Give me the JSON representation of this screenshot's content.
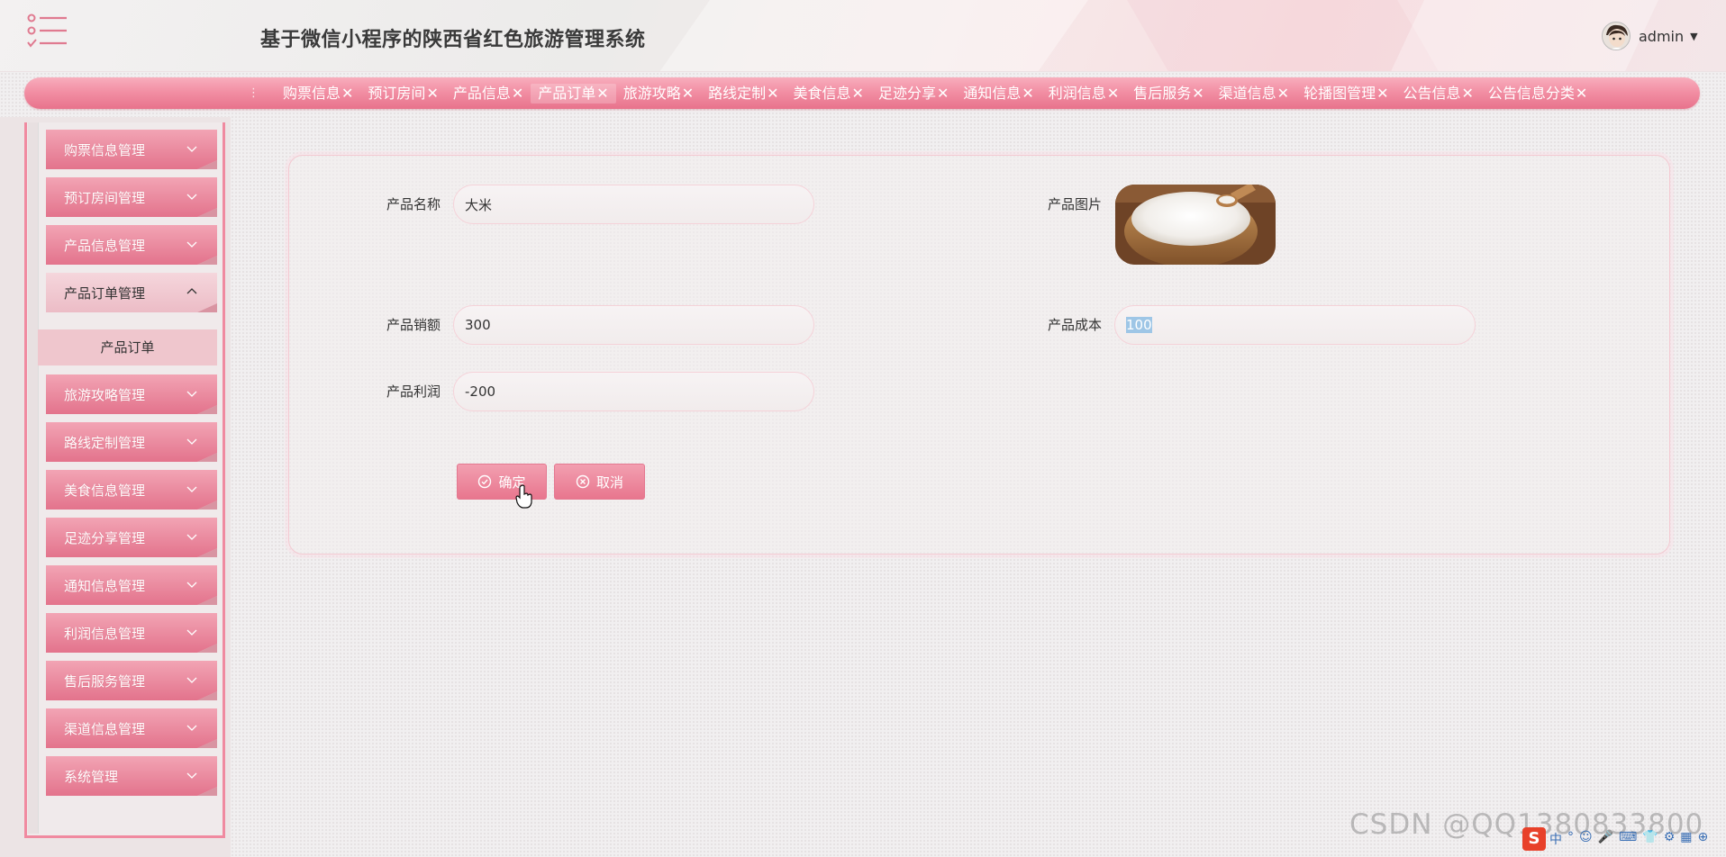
{
  "header": {
    "title": "基于微信小程序的陕西省红色旅游管理系统",
    "user_name": "admin",
    "caret": "▼"
  },
  "tabs": {
    "more": "⋮",
    "close_symbol": "✕",
    "items": [
      {
        "label": "购票信息"
      },
      {
        "label": "预订房间"
      },
      {
        "label": "产品信息"
      },
      {
        "label": "产品订单",
        "active": true
      },
      {
        "label": "旅游攻略"
      },
      {
        "label": "路线定制"
      },
      {
        "label": "美食信息"
      },
      {
        "label": "足迹分享"
      },
      {
        "label": "通知信息"
      },
      {
        "label": "利润信息"
      },
      {
        "label": "售后服务"
      },
      {
        "label": "渠道信息"
      },
      {
        "label": "轮播图管理"
      },
      {
        "label": "公告信息"
      },
      {
        "label": "公告信息分类"
      }
    ]
  },
  "sidebar": {
    "items": [
      {
        "label": "购票信息管理"
      },
      {
        "label": "预订房间管理"
      },
      {
        "label": "产品信息管理"
      },
      {
        "label": "产品订单管理",
        "open": true
      },
      {
        "label": "旅游攻略管理"
      },
      {
        "label": "路线定制管理"
      },
      {
        "label": "美食信息管理"
      },
      {
        "label": "足迹分享管理"
      },
      {
        "label": "通知信息管理"
      },
      {
        "label": "利润信息管理"
      },
      {
        "label": "售后服务管理"
      },
      {
        "label": "渠道信息管理"
      },
      {
        "label": "系统管理"
      }
    ],
    "sub_item": "产品订单"
  },
  "form": {
    "name_label": "产品名称",
    "name_value": "大米",
    "image_label": "产品图片",
    "sales_label": "产品销额",
    "sales_value": "300",
    "cost_label": "产品成本",
    "cost_value": "100",
    "profit_label": "产品利润",
    "profit_value": "-200",
    "confirm_label": "确定",
    "cancel_label": "取消"
  },
  "watermark": "CSDN @QQ1380833800",
  "tray": {
    "logo": "S",
    "icons": [
      "中",
      "°",
      "☺",
      "🎤",
      "⌨",
      "👕",
      "⚙",
      "▦",
      "⊕"
    ]
  },
  "colors": {
    "accent": "#f08aa0",
    "tab_bar": "#ef8da2",
    "selection": "#9ec6e6"
  }
}
